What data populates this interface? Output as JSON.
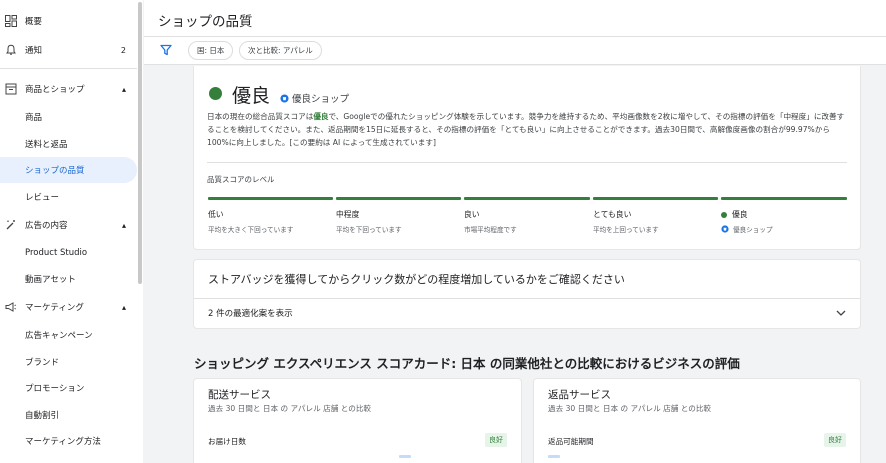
{
  "sidebar": {
    "items": [
      {
        "label": "概要",
        "icon": "dashboard-icon"
      },
      {
        "label": "通知",
        "icon": "bell-icon",
        "count": "2"
      },
      {
        "label": "商品とショップ",
        "icon": "storefront-icon"
      },
      {
        "label": "商品"
      },
      {
        "label": "送料と返品"
      },
      {
        "label": "ショップの品質"
      },
      {
        "label": "レビュー"
      },
      {
        "label": "広告の内容",
        "icon": "magic-wand-icon"
      },
      {
        "label": "Product Studio"
      },
      {
        "label": "動画アセット"
      },
      {
        "label": "マーケティング",
        "icon": "megaphone-icon"
      },
      {
        "label": "広告キャンペーン"
      },
      {
        "label": "ブランド"
      },
      {
        "label": "プロモーション"
      },
      {
        "label": "自動割引"
      },
      {
        "label": "マーケティング方法"
      }
    ]
  },
  "header": {
    "title": "ショップの品質"
  },
  "filters": {
    "country": "国: 日本",
    "compare": "次と比較: アパレル"
  },
  "rating": {
    "label": "優良",
    "badge": "優良ショップ",
    "summary_a": "日本の現在の総合品質スコアは",
    "summary_b": "優良",
    "summary_c": "で、Googleでの優れたショッピング体験を示しています。競争力を維持するため、平均画像数を2枚に増やして、その指標の評価を「中程度」に改善することを検討してください。また、返品期間を15日に延長すると、その指標の評価を「とても良い」に向上させることができます。過去30日間で、高解像度画像の割合が99.97%から100%に向上しました。[この要約は AI によって生成されています]",
    "levels_title": "品質スコアのレベル",
    "levels": [
      {
        "name": "低い",
        "desc": "平均を大きく下回っています"
      },
      {
        "name": "中程度",
        "desc": "平均を下回っています"
      },
      {
        "name": "良い",
        "desc": "市場平均程度です"
      },
      {
        "name": "とても良い",
        "desc": "平均を上回っています"
      },
      {
        "name": "優良",
        "desc": "優良ショップ"
      }
    ],
    "accent_color": "#34803a"
  },
  "badge_card": {
    "question": "ストアバッジを獲得してからクリック数がどの程度増加しているかをご確認ください",
    "optimizations": "2 件の最適化案を表示"
  },
  "scorecard": {
    "title": "ショッピング エクスペリエンス スコアカード: 日本 の同業他社との比較におけるビジネスの評価",
    "cards": [
      {
        "title": "配送サービス",
        "sub": "過去 30 日間と 日本 の アパレル 店舗 との比較",
        "metric": "お届け日数",
        "status": "良好"
      },
      {
        "title": "返品サービス",
        "sub": "過去 30 日間と 日本 の アパレル 店舗 との比較",
        "metric": "返品可能期間",
        "status": "良好"
      }
    ]
  }
}
